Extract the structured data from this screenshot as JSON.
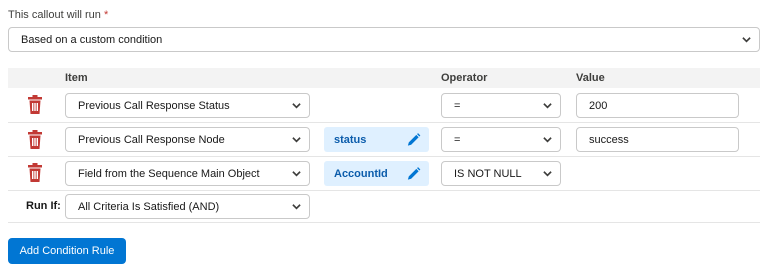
{
  "callout": {
    "label": "This callout will run",
    "required_mark": "*",
    "run_mode": "Based on a custom condition"
  },
  "table": {
    "headers": {
      "item": "Item",
      "operator": "Operator",
      "value": "Value"
    },
    "rows": [
      {
        "item": "Previous Call Response Status",
        "field": "",
        "operator": "=",
        "value": "200"
      },
      {
        "item": "Previous Call Response Node",
        "field": "status",
        "operator": "=",
        "value": "success"
      },
      {
        "item": "Field from the Sequence Main Object",
        "field": "AccountId",
        "operator": "IS NOT NULL",
        "value": ""
      }
    ]
  },
  "run_if": {
    "label": "Run If:",
    "value": "All Criteria Is Satisfied (AND)"
  },
  "add_rule_button": "Add Condition Rule",
  "colors": {
    "brand": "#0176d3",
    "delete": "#c23934",
    "pill_bg": "#dff0ff",
    "pill_text": "#0b5cab"
  }
}
